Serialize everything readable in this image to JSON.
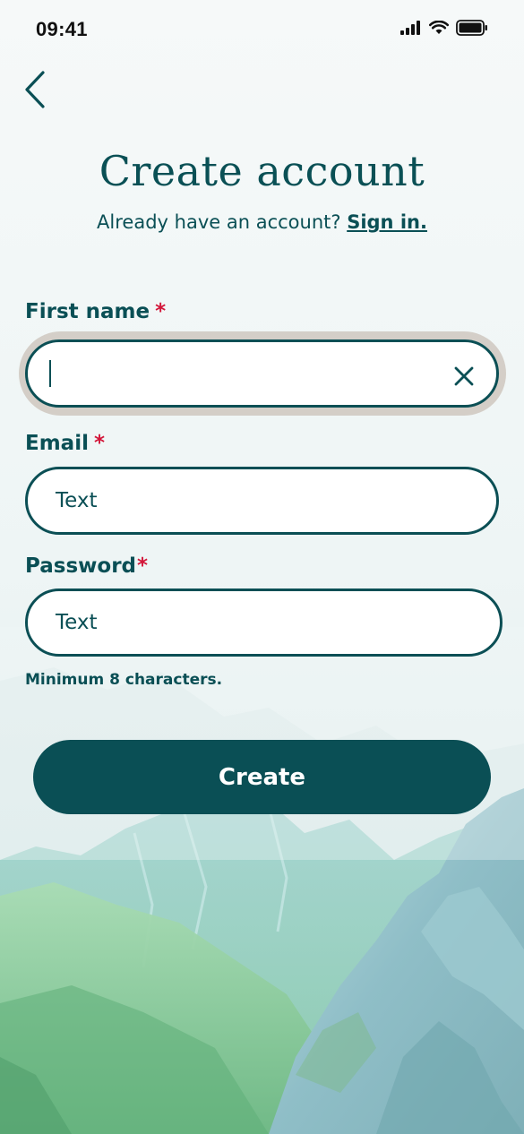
{
  "status_bar": {
    "time": "09:41"
  },
  "header": {
    "title": "Create account",
    "signin_prompt": "Already have an account?",
    "signin_link": "Sign in."
  },
  "form": {
    "required_marker": "*",
    "first_name": {
      "label": "First name",
      "value": ""
    },
    "email": {
      "label": "Email",
      "placeholder": "Text"
    },
    "password": {
      "label": "Password",
      "placeholder": "Text",
      "helper": "Minimum 8 characters."
    },
    "submit_label": "Create"
  },
  "icons": {
    "back": "chevron-left-icon",
    "clear": "close-icon",
    "signal": "cellular-signal-icon",
    "wifi": "wifi-icon",
    "battery": "battery-icon"
  },
  "colors": {
    "primary": "#0a4f55",
    "required": "#d3173a",
    "button_text": "#ffffff"
  }
}
